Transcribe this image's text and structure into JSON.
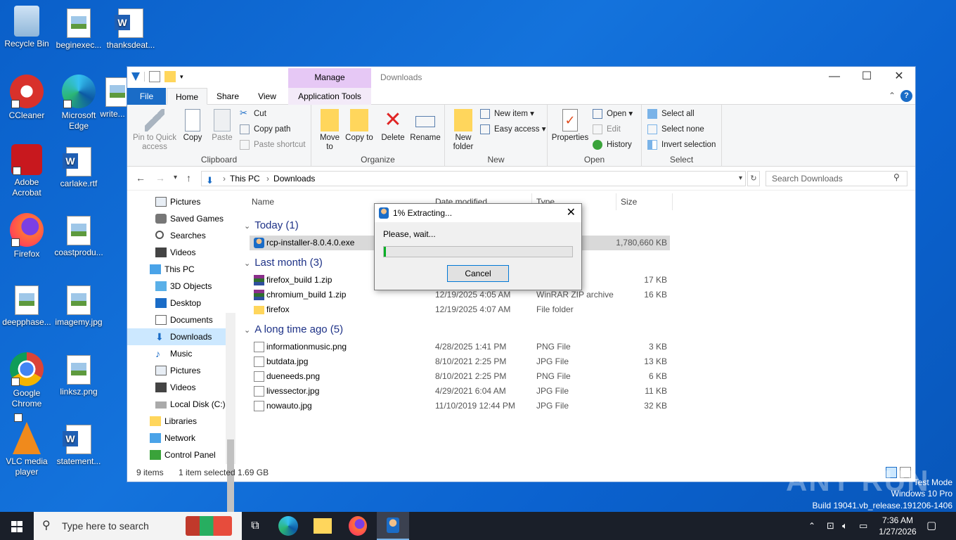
{
  "desktop": {
    "icons": [
      {
        "label": "Recycle Bin"
      },
      {
        "label": "beginexec..."
      },
      {
        "label": "thanksdeat..."
      },
      {
        "label": "CCleaner"
      },
      {
        "label": "Microsoft Edge"
      },
      {
        "label": "write..."
      },
      {
        "label": "Adobe Acrobat"
      },
      {
        "label": "carlake.rtf"
      },
      {
        "label": "Firefox"
      },
      {
        "label": "coastprodu..."
      },
      {
        "label": "deepphase..."
      },
      {
        "label": "imagemy.jpg"
      },
      {
        "label": "Google Chrome"
      },
      {
        "label": "linksz.png"
      },
      {
        "label": "VLC media player"
      },
      {
        "label": "statement..."
      }
    ]
  },
  "explorer": {
    "title": "Downloads",
    "manage_tab": "Manage",
    "tabs": {
      "file": "File",
      "home": "Home",
      "share": "Share",
      "view": "View",
      "app_tools": "Application Tools"
    },
    "ribbon": {
      "clipboard": {
        "label": "Clipboard",
        "pin": "Pin to Quick access",
        "copy": "Copy",
        "paste": "Paste",
        "cut": "Cut",
        "copy_path": "Copy path",
        "paste_shortcut": "Paste shortcut"
      },
      "organize": {
        "label": "Organize",
        "move_to": "Move to",
        "copy_to": "Copy to",
        "delete": "Delete",
        "rename": "Rename"
      },
      "new": {
        "label": "New",
        "new_folder": "New folder",
        "new_item": "New item",
        "easy_access": "Easy access"
      },
      "open": {
        "label": "Open",
        "properties": "Properties",
        "open": "Open",
        "edit": "Edit",
        "history": "History"
      },
      "select": {
        "label": "Select",
        "select_all": "Select all",
        "select_none": "Select none",
        "invert": "Invert selection"
      }
    },
    "address": {
      "this_pc": "This PC",
      "downloads": "Downloads",
      "search_placeholder": "Search Downloads"
    },
    "nav": [
      {
        "label": "Pictures"
      },
      {
        "label": "Saved Games"
      },
      {
        "label": "Searches"
      },
      {
        "label": "Videos"
      },
      {
        "label": "This PC"
      },
      {
        "label": "3D Objects"
      },
      {
        "label": "Desktop"
      },
      {
        "label": "Documents"
      },
      {
        "label": "Downloads"
      },
      {
        "label": "Music"
      },
      {
        "label": "Pictures"
      },
      {
        "label": "Videos"
      },
      {
        "label": "Local Disk (C:)"
      },
      {
        "label": "Libraries"
      },
      {
        "label": "Network"
      },
      {
        "label": "Control Panel"
      }
    ],
    "columns": {
      "name": "Name",
      "date": "Date modified",
      "type": "Type",
      "size": "Size"
    },
    "groups": {
      "today": "Today (1)",
      "last_month": "Last month (3)",
      "long_ago": "A long time ago (5)"
    },
    "files": [
      {
        "name": "rcp-installer-8.0.4.0.exe",
        "date": "",
        "type": "",
        "size": "1,780,660 KB"
      },
      {
        "name": "firefox_build 1.zip",
        "date": "",
        "type": "archive",
        "size": "17 KB"
      },
      {
        "name": "chromium_build 1.zip",
        "date": "12/19/2025 4:05 AM",
        "type": "WinRAR ZIP archive",
        "size": "16 KB"
      },
      {
        "name": "firefox",
        "date": "12/19/2025 4:07 AM",
        "type": "File folder",
        "size": ""
      },
      {
        "name": "informationmusic.png",
        "date": "4/28/2025 1:41 PM",
        "type": "PNG File",
        "size": "3 KB"
      },
      {
        "name": "butdata.jpg",
        "date": "8/10/2021 2:25 PM",
        "type": "JPG File",
        "size": "13 KB"
      },
      {
        "name": "dueneeds.png",
        "date": "8/10/2021 2:25 PM",
        "type": "PNG File",
        "size": "6 KB"
      },
      {
        "name": "livessector.jpg",
        "date": "4/29/2021 6:04 AM",
        "type": "JPG File",
        "size": "11 KB"
      },
      {
        "name": "nowauto.jpg",
        "date": "11/10/2019 12:44 PM",
        "type": "JPG File",
        "size": "32 KB"
      }
    ],
    "status": {
      "items": "9 items",
      "selected": "1 item selected  1.69 GB"
    }
  },
  "dialog": {
    "title": "1% Extracting...",
    "message": "Please, wait...",
    "progress": 0.01,
    "cancel": "Cancel"
  },
  "taskbar": {
    "search_placeholder": "Type here to search",
    "time": "7:36 AM",
    "date": "1/27/2026"
  },
  "watermark": {
    "line1": "Test Mode",
    "line2": "Windows 10 Pro",
    "line3": "Build 19041.vb_release.191206-1406",
    "brand": "ANY RUN"
  },
  "colors": {
    "accent": "#1a6cc7",
    "selection": "#cce8ff",
    "progress": "#06b025",
    "manage": "#e6c8f5"
  }
}
